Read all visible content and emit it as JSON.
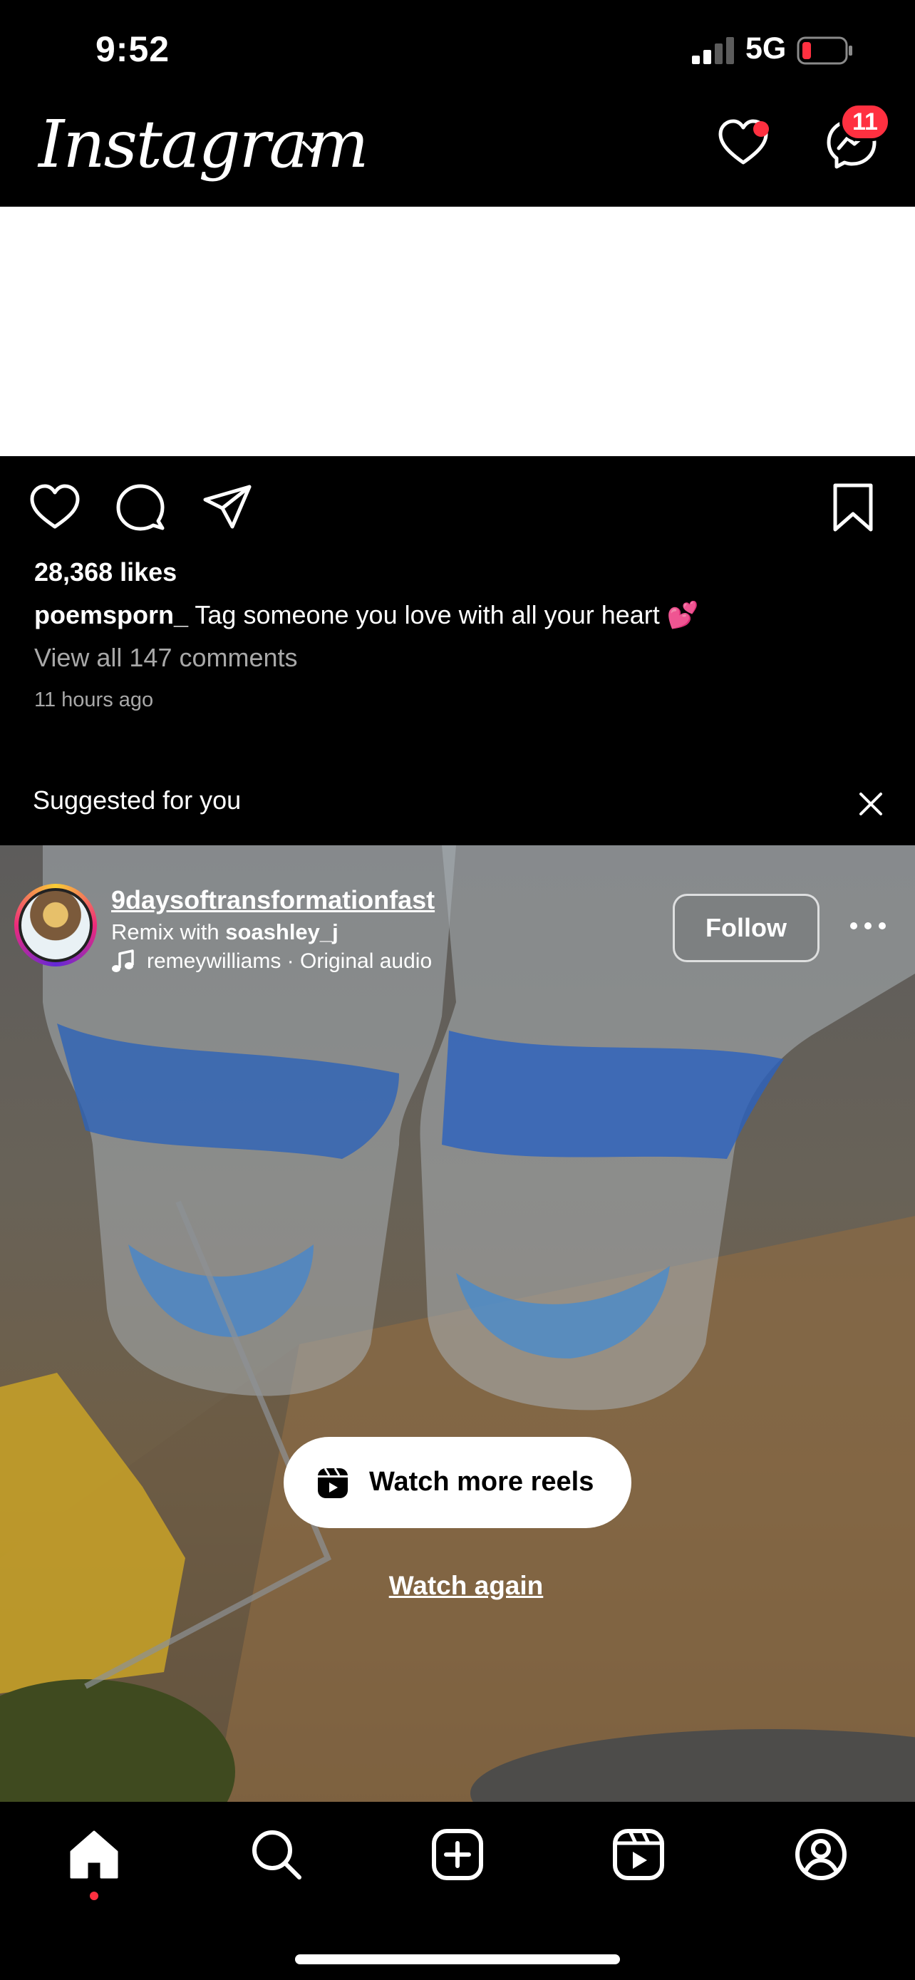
{
  "status_bar": {
    "time": "9:52",
    "network": "5G"
  },
  "header": {
    "logo_text": "Instagram",
    "messages_badge": "11"
  },
  "post": {
    "likes": "28,368 likes",
    "username": "poemsporn_",
    "caption": "Tag someone you love with all your heart 💕",
    "comments_link": "View all 147 comments",
    "time_ago": "11 hours ago"
  },
  "suggested": {
    "label": "Suggested for you"
  },
  "reel": {
    "username": "9daysoftransformationfast",
    "remix_prefix": "Remix with",
    "remix_user": "soashley_j",
    "audio": "remeywilliams · Original audio",
    "follow_label": "Follow",
    "watch_more_label": "Watch more reels",
    "watch_again_label": "Watch again"
  },
  "colors": {
    "accent_red": "#ff3040",
    "background": "#000000"
  },
  "icons": [
    "heart-icon",
    "messenger-icon",
    "comment-icon",
    "share-icon",
    "bookmark-icon",
    "close-icon",
    "music-note-icon",
    "more-icon",
    "reels-icon",
    "home-icon",
    "search-icon",
    "create-icon",
    "profile-icon"
  ]
}
